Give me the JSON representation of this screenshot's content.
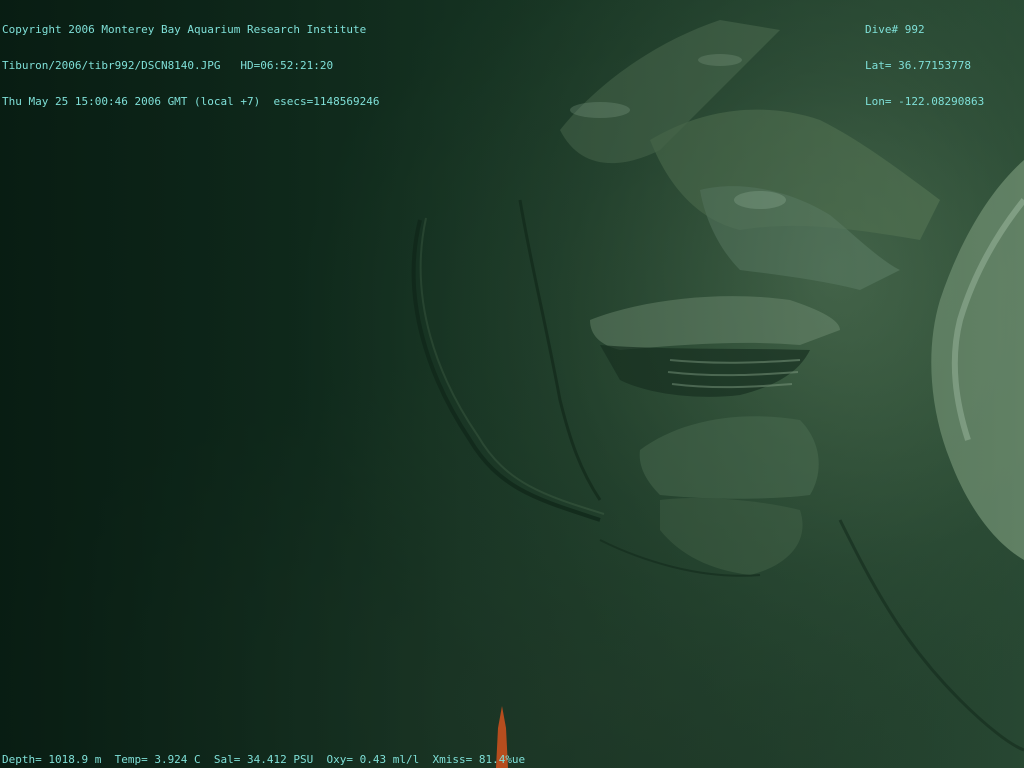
{
  "overlay": {
    "top_left": [
      "Copyright 2006 Monterey Bay Aquarium Research Institute",
      "Tiburon/2006/tibr992/DSCN8140.JPG   HD=06:52:21:20",
      "Thu May 25 15:00:46 2006 GMT (local +7)  esecs=1148569246"
    ],
    "top_right": [
      "Dive# 992",
      "Lat= 36.77153778",
      "Lon= -122.08290863"
    ],
    "bottom": "Depth= 1018.9 m  Temp= 3.924 C  Sal= 34.412 PSU  Oxy= 0.43 ml/l  Xmiss= 81.4%ue"
  },
  "scene": {
    "subject": "deep-sea seafloor with layered rock outcrop",
    "colors": {
      "water_dark": "#0c2418",
      "sediment": "#2e4c36",
      "rock_light": "#5a7a5e",
      "crust_white": "#9fbfa4",
      "marker_orange": "#c8501e",
      "overlay_text": "#7fe0d8"
    }
  }
}
